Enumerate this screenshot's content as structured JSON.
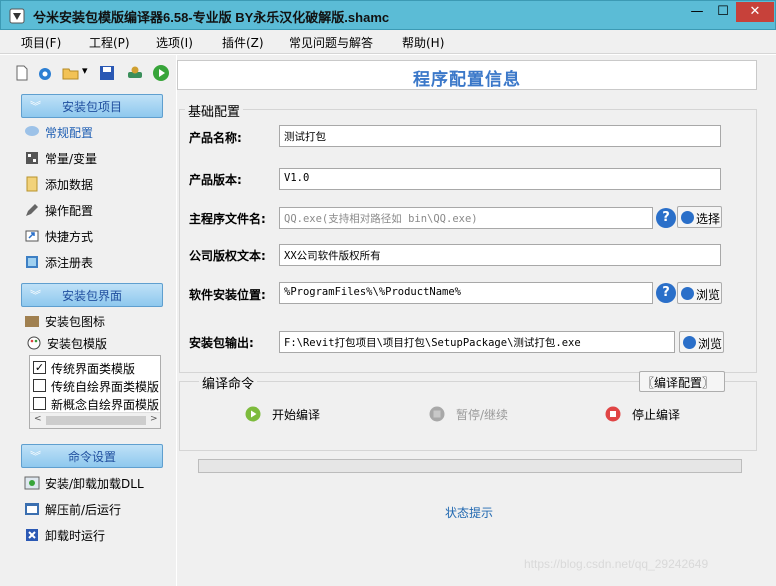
{
  "window": {
    "title": "兮米安装包模版编译器6.58-专业版 BY永乐汉化破解版.shamc",
    "minimize_glyph": "—",
    "maximize_glyph": "☐",
    "close_glyph": "✕"
  },
  "menu": [
    "项目(F)",
    "工程(P)",
    "选项(I)",
    "插件(Z)",
    "常见问题与解答",
    "帮助(H)"
  ],
  "toolbar": {
    "icons": [
      "new-file-icon",
      "open-project-icon",
      "open-folder-icon",
      "dropdown-arrow-icon",
      "save-icon",
      "build-icon",
      "run-icon"
    ],
    "dropdown_glyph": "▾"
  },
  "sidebar": {
    "group1": "安装包项目",
    "group1_items": [
      "常规配置",
      "常量/变量",
      "添加数据",
      "操作配置",
      "快捷方式",
      "添注册表"
    ],
    "group2": "安装包界面",
    "group2_items": [
      "安装包图标",
      "安装包模版"
    ],
    "templates": [
      {
        "label": "传统界面类模版",
        "checked": true
      },
      {
        "label": "传统自绘界面类模版",
        "checked": false
      },
      {
        "label": "新概念自绘界面模版",
        "checked": false
      }
    ],
    "check_glyph": "✓",
    "scroll_left": "<",
    "scroll_right": ">",
    "group3": "命令设置",
    "group3_items": [
      "安装/卸载加载DLL",
      "解压前/后运行",
      "卸载时运行"
    ],
    "chevron_glyph": "︾"
  },
  "main": {
    "header_title": "程序配置信息",
    "basic_section": "基础配置",
    "fields": {
      "product_name": {
        "label": "产品名称:",
        "value": "测试打包"
      },
      "product_version": {
        "label": "产品版本:",
        "value": "V1.0"
      },
      "main_exe": {
        "label": "主程序文件名:",
        "placeholder": "QQ.exe(支持相对路径如 bin\\QQ.exe)"
      },
      "copyright": {
        "label": "公司版权文本:",
        "value": "XX公司软件版权所有"
      },
      "install_location": {
        "label": "软件安装位置:",
        "value": "%ProgramFiles%\\%ProductName%"
      },
      "output": {
        "label": "安装包输出:",
        "value": "F:\\Revit打包项目\\项目打包\\SetupPackage\\测试打包.exe"
      }
    },
    "help_glyph": "?",
    "select_button": "选择",
    "browse_button": "浏览",
    "compile_section": "编译命令",
    "compile_config_button": "〖编译配置〗",
    "start_compile": "开始编译",
    "pause_resume": "暂停/继续",
    "stop_compile": "停止编译",
    "progress": 0,
    "status_text": "状态提示"
  },
  "watermark": "https://blog.csdn.net/qq_29242649"
}
